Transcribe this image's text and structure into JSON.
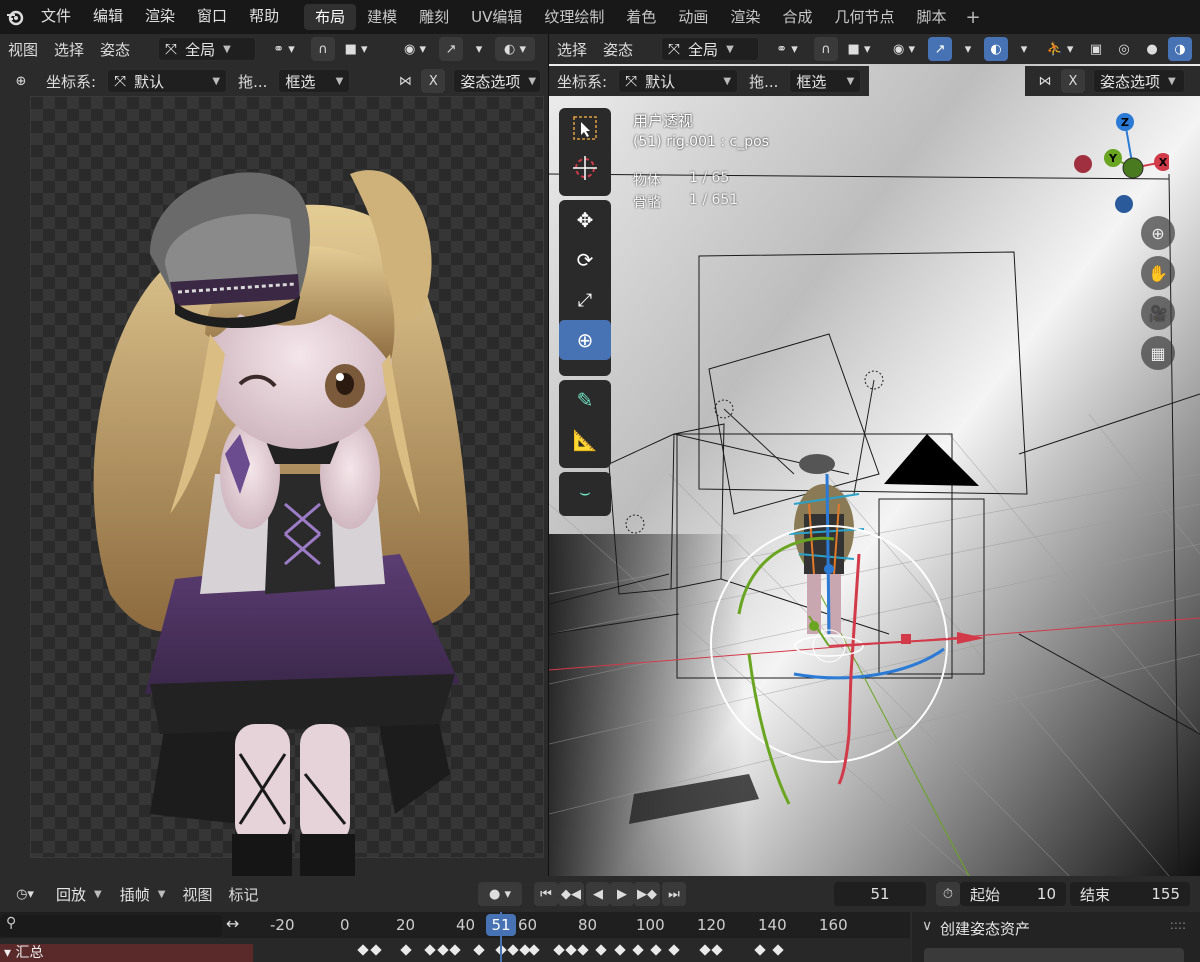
{
  "topbar": {
    "menus": [
      "文件",
      "编辑",
      "渲染",
      "窗口",
      "帮助"
    ],
    "workspaces": [
      "布局",
      "建模",
      "雕刻",
      "UV编辑",
      "纹理绘制",
      "着色",
      "动画",
      "渲染",
      "合成",
      "几何节点",
      "脚本"
    ],
    "active_workspace": "布局",
    "add_tab": "+"
  },
  "left_editor": {
    "header1": {
      "view": "视图",
      "select": "选择",
      "pose": "姿态",
      "transform_orientation": "全局"
    },
    "header2": {
      "coord_label": "坐标系:",
      "coord_value": "默认",
      "drag_label": "拖...",
      "box_select": "框选",
      "x_label": "X",
      "pose_options": "姿态选项"
    }
  },
  "right_editor": {
    "header1": {
      "select": "选择",
      "pose": "姿态",
      "transform_orientation": "全局"
    },
    "header2": {
      "coord_label": "坐标系:",
      "coord_value": "默认",
      "drag_label": "拖...",
      "box_select": "框选",
      "x_label": "X",
      "pose_options": "姿态选项"
    },
    "overlay": {
      "view_name": "用户透视",
      "active": "(51) rig.001 : c_pos",
      "objects_label": "物体",
      "objects_value": "1 / 65",
      "bones_label": "骨骼",
      "bones_value": "1 / 651"
    },
    "gizmo_axes": {
      "z": "Z",
      "y": "Y",
      "x": "X"
    },
    "colors": {
      "x_axis": "#d23a4a",
      "y_axis": "#6aa522",
      "z_axis": "#2b7bd6",
      "accent": "#4772b3"
    }
  },
  "timeline": {
    "playback": "回放",
    "keying": "插帧",
    "view": "视图",
    "marker": "标记",
    "current_frame": "51",
    "start_label": "起始",
    "start_value": "10",
    "end_label": "结束",
    "end_value": "155",
    "ruler": [
      "-20",
      "0",
      "20",
      "40",
      "51",
      "60",
      "80",
      "100",
      "120",
      "140",
      "160"
    ],
    "summary_label": "汇总",
    "keyframes": [
      6,
      10,
      20,
      28,
      32,
      36,
      44,
      51,
      55,
      59,
      62,
      70,
      74,
      78,
      84,
      90,
      96,
      102,
      108,
      118,
      122,
      136,
      142
    ],
    "side_panel_title": "创建姿态资产",
    "side_panel_dots": "::::"
  }
}
